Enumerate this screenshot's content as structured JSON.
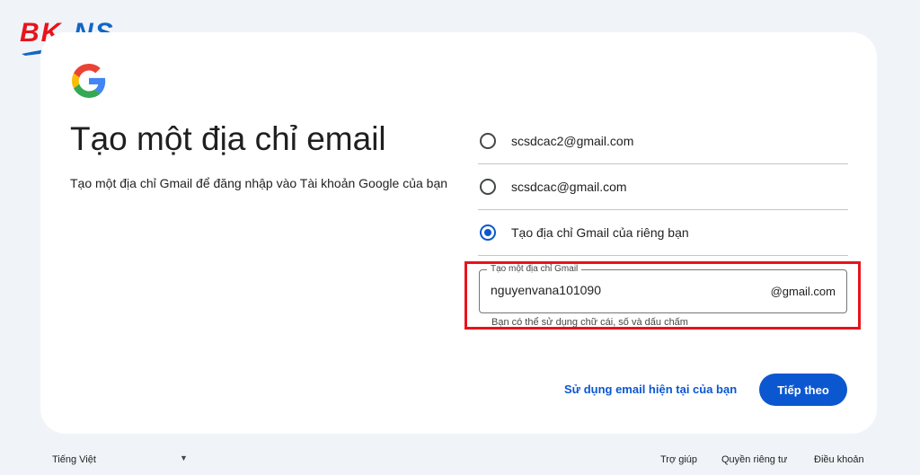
{
  "watermark": {
    "text": "BKNS"
  },
  "header": {
    "title": "Tạo một địa chỉ email",
    "subtitle": "Tạo một địa chỉ Gmail để đăng nhập vào Tài khoản Google của bạn"
  },
  "options": [
    {
      "label": "scsdcac2@gmail.com",
      "selected": false
    },
    {
      "label": "scsdcac@gmail.com",
      "selected": false
    },
    {
      "label": "Tạo địa chỉ Gmail của riêng bạn",
      "selected": true
    }
  ],
  "gmail_field": {
    "label": "Tạo một địa chỉ Gmail",
    "value": "nguyenvana101090",
    "suffix": "@gmail.com",
    "helper": "Bạn có thể sử dụng chữ cái, số và dấu chấm"
  },
  "actions": {
    "secondary": "Sử dụng email hiện tại của bạn",
    "primary": "Tiếp theo"
  },
  "footer": {
    "language": "Tiếng Việt",
    "help": "Trợ giúp",
    "privacy": "Quyền riêng tư",
    "terms": "Điều khoản"
  },
  "colors": {
    "accent": "#0b57d0",
    "highlight": "#e8141b",
    "background": "#f0f4f9",
    "watermark_red": "#e8141b",
    "watermark_blue": "#1266c5"
  },
  "icons": {
    "logo": "google-g-icon",
    "language_caret": "caret-down-icon"
  }
}
